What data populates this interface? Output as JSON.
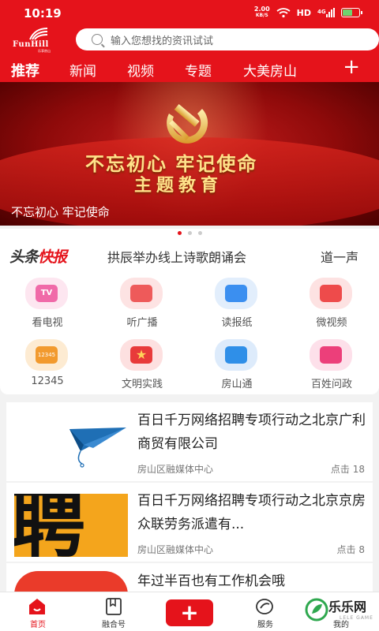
{
  "status_bar": {
    "time": "10:19",
    "speed_value": "2.00",
    "speed_unit": "KB/S",
    "hd": "HD",
    "signal": "4G",
    "battery_level": 0.55
  },
  "brand": {
    "logo_text": "FunHill",
    "logo_sub": "乐享房山"
  },
  "search": {
    "placeholder": "输入您想找的资讯试试"
  },
  "tabs": [
    "推荐",
    "新闻",
    "视频",
    "专题",
    "大美房山"
  ],
  "tabs_active": "推荐",
  "tabs_add": "+",
  "banner": {
    "headline_line1": "不忘初心 牢记使命",
    "headline_line2": "主题教育",
    "caption": "不忘初心 牢记使命",
    "page_count": 3,
    "active_page": 1
  },
  "ticker": {
    "logo_part1": "头条",
    "logo_part2": "快报",
    "text": "拱辰举办线上诗歌朗诵会",
    "text_next": "道一声"
  },
  "services": [
    {
      "label": "看电视",
      "icon": "tv-icon",
      "color": "#f06aa8"
    },
    {
      "label": "听广播",
      "icon": "radio-icon",
      "color": "#ee5a5a"
    },
    {
      "label": "读报纸",
      "icon": "newspaper-icon",
      "color": "#3b8ff0"
    },
    {
      "label": "微视频",
      "icon": "video-camera-icon",
      "color": "#ee4b4b"
    },
    {
      "label": "12345",
      "icon": "hotline-12345-icon",
      "color": "#f29a2e"
    },
    {
      "label": "文明实践",
      "icon": "star-icon",
      "color": "#e83a3a"
    },
    {
      "label": "房山通",
      "icon": "briefcase-icon",
      "color": "#2f8fe8"
    },
    {
      "label": "百姓问政",
      "icon": "building-icon",
      "color": "#ec3f7a"
    }
  ],
  "ticker_tv_text": "TV",
  "hotline_badge": "12345",
  "news": [
    {
      "title": "百日千万网络招聘专项行动之北京广利商贸有限公司",
      "source": "房山区融媒体中心",
      "clicks": "点击 18",
      "thumb": "paper-plane-icon"
    },
    {
      "title": "百日千万网络招聘专项行动之北京京房众联劳务派遣有...",
      "source": "房山区融媒体中心",
      "clicks": "点击 8",
      "thumb": "recruit-character-icon",
      "thumb_text": "聘"
    },
    {
      "title": "年过半百也有工作机会哦",
      "source": "",
      "clicks": "",
      "thumb": "job-banner-icon"
    }
  ],
  "bottom_nav": [
    {
      "label": "首页",
      "icon": "home-icon",
      "active": true
    },
    {
      "label": "融合号",
      "icon": "bookmark-icon",
      "active": false
    },
    {
      "label": "+",
      "icon": "add-icon",
      "active": false
    },
    {
      "label": "服务",
      "icon": "service-icon",
      "active": false
    },
    {
      "label": "我的",
      "icon": "profile-icon",
      "active": false
    }
  ],
  "watermark": {
    "text": "乐乐网",
    "sub": "LELE GAME"
  },
  "colors": {
    "brand_red": "#e5131b",
    "gold": "#ffe28a"
  }
}
